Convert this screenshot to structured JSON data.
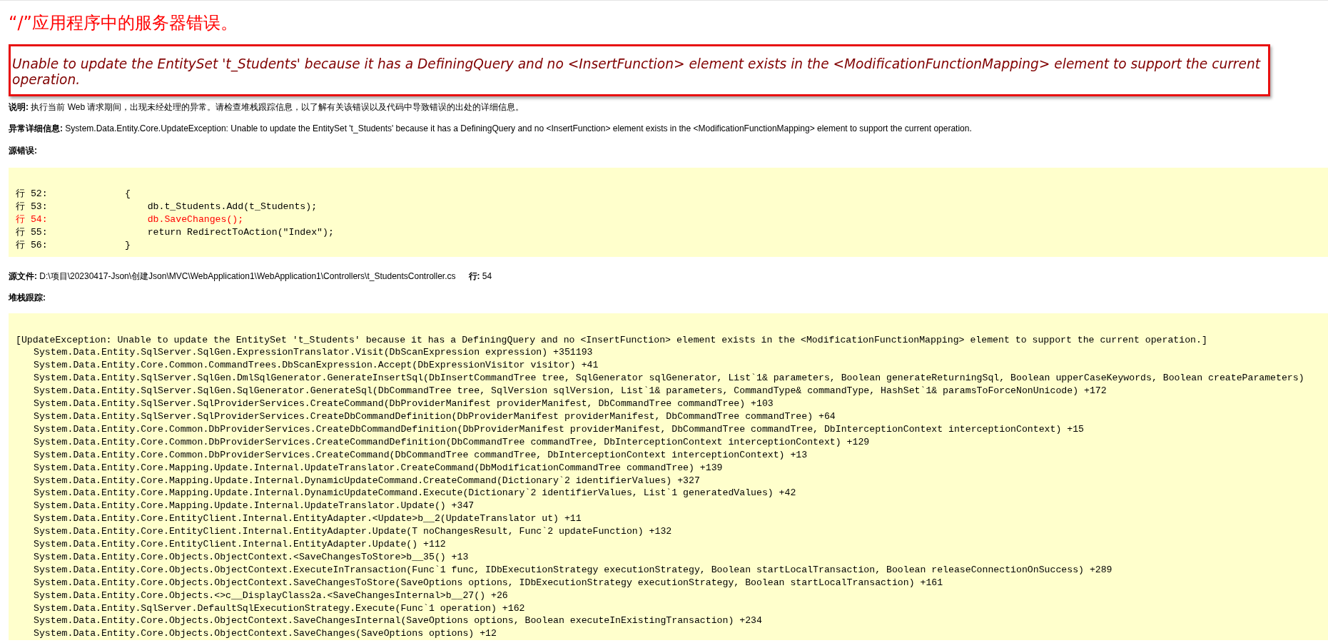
{
  "title": "“/”应用程序中的服务器错误。",
  "error_message": "Unable to update the EntitySet 't_Students' because it has a DefiningQuery and no <InsertFunction> element exists in the <ModificationFunctionMapping> element to support the current operation.",
  "description": "**说明:** 执行当前 Web 请求期间，出现未经处理的异常。请检查堆栈跟踪信息，以了解有关该错误以及代码中导致错误的出处的详细信息。",
  "exception_details": "**异常详细信息:** System.Data.Entity.Core.UpdateException: Unable to update the EntitySet 't_Students' because it has a DefiningQuery and no <InsertFunction> element exists in the <ModificationFunctionMapping> element to support the current operation.",
  "source_error": {
    "label": "源错误:",
    "lines": [
      {
        "line_label": "行 52:",
        "code": "{",
        "highlighted": false
      },
      {
        "line_label": "行 53:",
        "code": "    db.t_Students.Add(t_Students);",
        "highlighted": false
      },
      {
        "line_label": "行 54:",
        "code": "    db.SaveChanges();",
        "highlighted": true
      },
      {
        "line_label": "行 55:",
        "code": "    return RedirectToAction(\"Index\");",
        "highlighted": false
      },
      {
        "line_label": "行 56:",
        "code": "}",
        "highlighted": false
      }
    ]
  },
  "source_file": {
    "path": "**源文件:** D:\\项目\\20230417-Json\\创建Json\\MVC\\WebApplication1\\WebApplication1\\Controllers\\t_StudentsController.cs",
    "line": "**行:** 54"
  },
  "stack_trace": {
    "label": "堆栈跟踪:",
    "lines": [
      {
        "kind": "header",
        "text": "[UpdateException: Unable to update the EntitySet 't_Students' because it has a DefiningQuery and no <InsertFunction> element exists in the <ModificationFunctionMapping> element to support the current operation.]"
      },
      {
        "kind": "frame",
        "text": "System.Data.Entity.SqlServer.SqlGen.ExpressionTranslator.Visit(DbScanExpression expression) +351193"
      },
      {
        "kind": "frame",
        "text": "System.Data.Entity.Core.Common.CommandTrees.DbScanExpression.Accept(DbExpressionVisitor visitor) +41"
      },
      {
        "kind": "frame",
        "text": "System.Data.Entity.SqlServer.SqlGen.DmlSqlGenerator.GenerateInsertSql(DbInsertCommandTree tree, SqlGenerator sqlGenerator, List`1& parameters, Boolean generateReturningSql, Boolean upperCaseKeywords, Boolean createParameters)"
      },
      {
        "kind": "frame",
        "text": "System.Data.Entity.SqlServer.SqlGen.SqlGenerator.GenerateSql(DbCommandTree tree, SqlVersion sqlVersion, List`1& parameters, CommandType& commandType, HashSet`1& paramsToForceNonUnicode) +172"
      },
      {
        "kind": "frame",
        "text": "System.Data.Entity.SqlServer.SqlProviderServices.CreateCommand(DbProviderManifest providerManifest, DbCommandTree commandTree) +103"
      },
      {
        "kind": "frame",
        "text": "System.Data.Entity.SqlServer.SqlProviderServices.CreateDbCommandDefinition(DbProviderManifest providerManifest, DbCommandTree commandTree) +64"
      },
      {
        "kind": "frame",
        "text": "System.Data.Entity.Core.Common.DbProviderServices.CreateDbCommandDefinition(DbProviderManifest providerManifest, DbCommandTree commandTree, DbInterceptionContext interceptionContext) +15"
      },
      {
        "kind": "frame",
        "text": "System.Data.Entity.Core.Common.DbProviderServices.CreateCommandDefinition(DbCommandTree commandTree, DbInterceptionContext interceptionContext) +129"
      },
      {
        "kind": "frame",
        "text": "System.Data.Entity.Core.Common.DbProviderServices.CreateCommand(DbCommandTree commandTree, DbInterceptionContext interceptionContext) +13"
      },
      {
        "kind": "frame",
        "text": "System.Data.Entity.Core.Mapping.Update.Internal.UpdateTranslator.CreateCommand(DbModificationCommandTree commandTree) +139"
      },
      {
        "kind": "frame",
        "text": "System.Data.Entity.Core.Mapping.Update.Internal.DynamicUpdateCommand.CreateCommand(Dictionary`2 identifierValues) +327"
      },
      {
        "kind": "frame",
        "text": "System.Data.Entity.Core.Mapping.Update.Internal.DynamicUpdateCommand.Execute(Dictionary`2 identifierValues, List`1 generatedValues) +42"
      },
      {
        "kind": "frame",
        "text": "System.Data.Entity.Core.Mapping.Update.Internal.UpdateTranslator.Update() +347"
      },
      {
        "kind": "frame",
        "text": "System.Data.Entity.Core.EntityClient.Internal.EntityAdapter.<Update>b__2(UpdateTranslator ut) +11"
      },
      {
        "kind": "frame",
        "text": "System.Data.Entity.Core.EntityClient.Internal.EntityAdapter.Update(T noChangesResult, Func`2 updateFunction) +132"
      },
      {
        "kind": "frame",
        "text": "System.Data.Entity.Core.EntityClient.Internal.EntityAdapter.Update() +112"
      },
      {
        "kind": "frame",
        "text": "System.Data.Entity.Core.Objects.ObjectContext.<SaveChangesToStore>b__35() +13"
      },
      {
        "kind": "frame",
        "text": "System.Data.Entity.Core.Objects.ObjectContext.ExecuteInTransaction(Func`1 func, IDbExecutionStrategy executionStrategy, Boolean startLocalTransaction, Boolean releaseConnectionOnSuccess) +289"
      },
      {
        "kind": "frame",
        "text": "System.Data.Entity.Core.Objects.ObjectContext.SaveChangesToStore(SaveOptions options, IDbExecutionStrategy executionStrategy, Boolean startLocalTransaction) +161"
      },
      {
        "kind": "frame",
        "text": "System.Data.Entity.Core.Objects.<>c__DisplayClass2a.<SaveChangesInternal>b__27() +26"
      },
      {
        "kind": "frame",
        "text": "System.Data.Entity.SqlServer.DefaultSqlExecutionStrategy.Execute(Func`1 operation) +162"
      },
      {
        "kind": "frame",
        "text": "System.Data.Entity.Core.Objects.ObjectContext.SaveChangesInternal(SaveOptions options, Boolean executeInExistingTransaction) +234"
      },
      {
        "kind": "frame",
        "text": "System.Data.Entity.Core.Objects.ObjectContext.SaveChanges(SaveOptions options) +12"
      }
    ]
  }
}
